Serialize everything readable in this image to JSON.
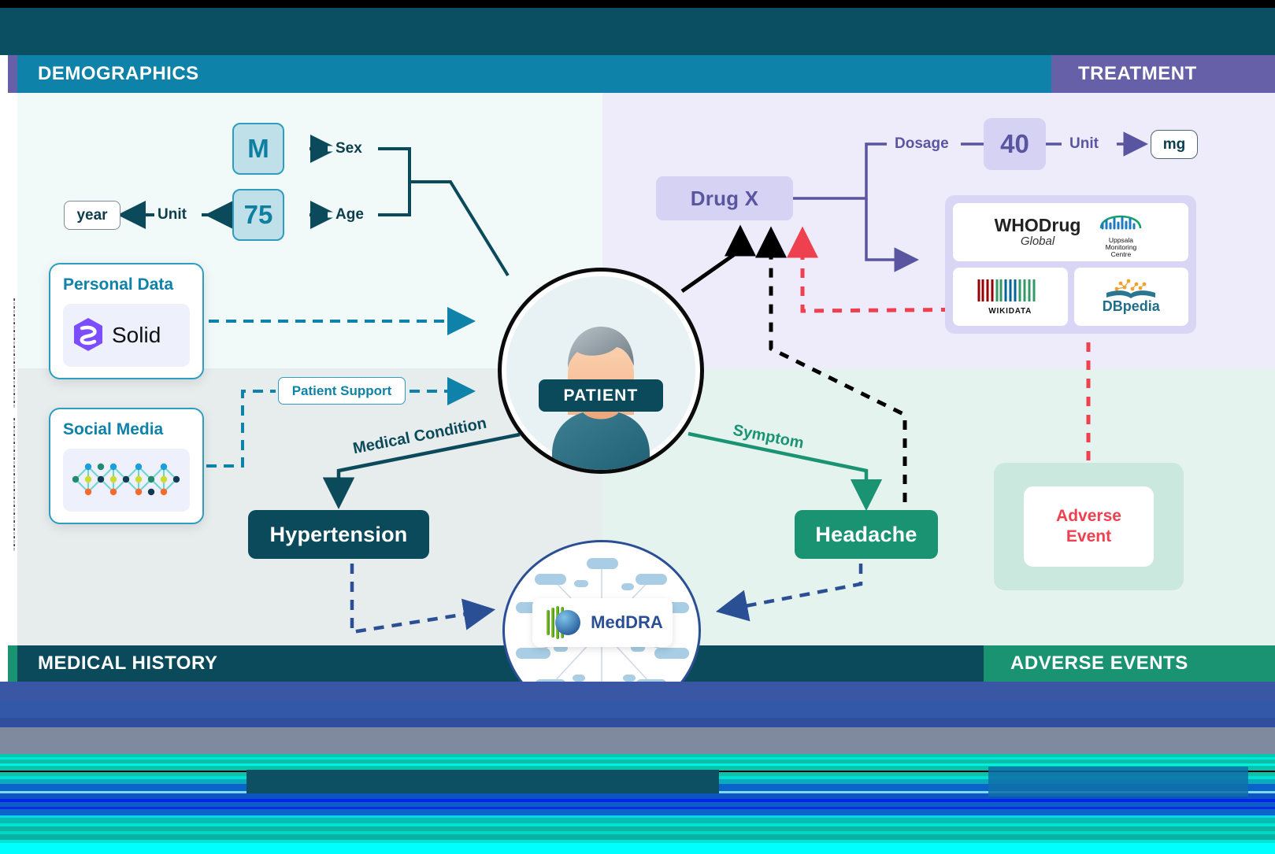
{
  "top_banner": {
    "ghost_text": ""
  },
  "quadrants": {
    "demographics": {
      "label": "DEMOGRAPHICS"
    },
    "treatment": {
      "label": "TREATMENT"
    },
    "medical_history": {
      "label": "MEDICAL HISTORY"
    },
    "adverse_events": {
      "label": "ADVERSE EVENTS"
    }
  },
  "demographics": {
    "sex": {
      "edge_label": "Sex",
      "value": "M"
    },
    "age": {
      "edge_label": "Age",
      "value": "75",
      "unit_label": "Unit",
      "unit_value": "year"
    },
    "sources": [
      {
        "title": "Personal Data",
        "logo": "solid-logo",
        "logo_text": "Solid"
      },
      {
        "title": "Social Media",
        "logo": "social-network-icon"
      }
    ],
    "patient_support": {
      "label": "Patient Support"
    }
  },
  "treatment": {
    "drug": {
      "label": "Drug X"
    },
    "dosage": {
      "edge_label": "Dosage",
      "value": "40",
      "unit_label": "Unit",
      "unit_value": "mg"
    },
    "ontologies": [
      {
        "name": "WHODrug",
        "sub": "Global"
      },
      {
        "name": "Uppsala Monitoring Centre",
        "line1": "Uppsala",
        "line2": "Monitoring",
        "line3": "Centre"
      },
      {
        "name": "WIKIDATA"
      },
      {
        "name": "DBpedia"
      }
    ]
  },
  "center": {
    "patient": {
      "label": "PATIENT",
      "avatar": "patient-avatar-icon"
    },
    "meddra": {
      "label": "MedDRA"
    }
  },
  "nodes": {
    "hypertension": {
      "label": "Hypertension",
      "edge_label": "Medical Condition"
    },
    "headache": {
      "label": "Headache",
      "edge_label": "Symptom"
    },
    "adverse_event": {
      "line1": "Adverse",
      "line2": "Event"
    }
  },
  "colors": {
    "demographics_header": "#0e82a8",
    "treatment_header": "#6560a8",
    "medical_history_header": "#0b4a5a",
    "adverse_events_header": "#199372",
    "teal_dark": "#0b4a5a",
    "green": "#199372",
    "red": "#ef4050",
    "purple": "#5a55a0",
    "blue_dashed": "#2b4f94"
  }
}
